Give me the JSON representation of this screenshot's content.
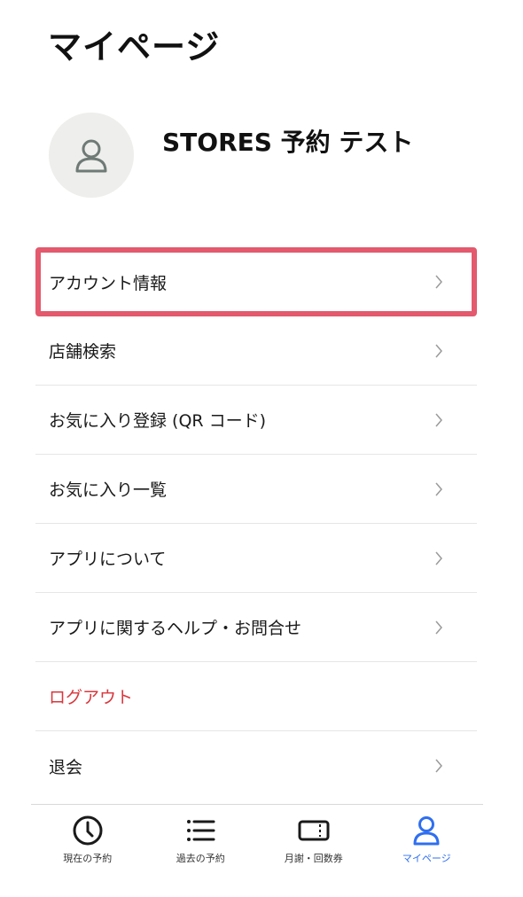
{
  "header": {
    "title": "マイページ"
  },
  "profile": {
    "name": "STORES 予約 テスト",
    "avatar_icon": "user-icon"
  },
  "menu": {
    "items": [
      {
        "label": "アカウント情報",
        "highlighted": true
      },
      {
        "label": "店舗検索"
      },
      {
        "label": "お気に入り登録 (QR コード)"
      },
      {
        "label": "お気に入り一覧"
      },
      {
        "label": "アプリについて"
      },
      {
        "label": "アプリに関するヘルプ・お問合せ"
      },
      {
        "label": "ログアウト",
        "style": "danger"
      },
      {
        "label": "退会"
      }
    ]
  },
  "tabbar": {
    "tabs": [
      {
        "label": "現在の予約",
        "icon": "clock-icon"
      },
      {
        "label": "過去の予約",
        "icon": "list-icon"
      },
      {
        "label": "月謝・回数券",
        "icon": "ticket-icon"
      },
      {
        "label": "マイページ",
        "icon": "user-icon",
        "active": true
      }
    ]
  },
  "colors": {
    "accent": "#2f6ff0",
    "highlight_border": "#e3596d",
    "danger": "#d8373c",
    "avatar_bg": "#eeeeec"
  }
}
